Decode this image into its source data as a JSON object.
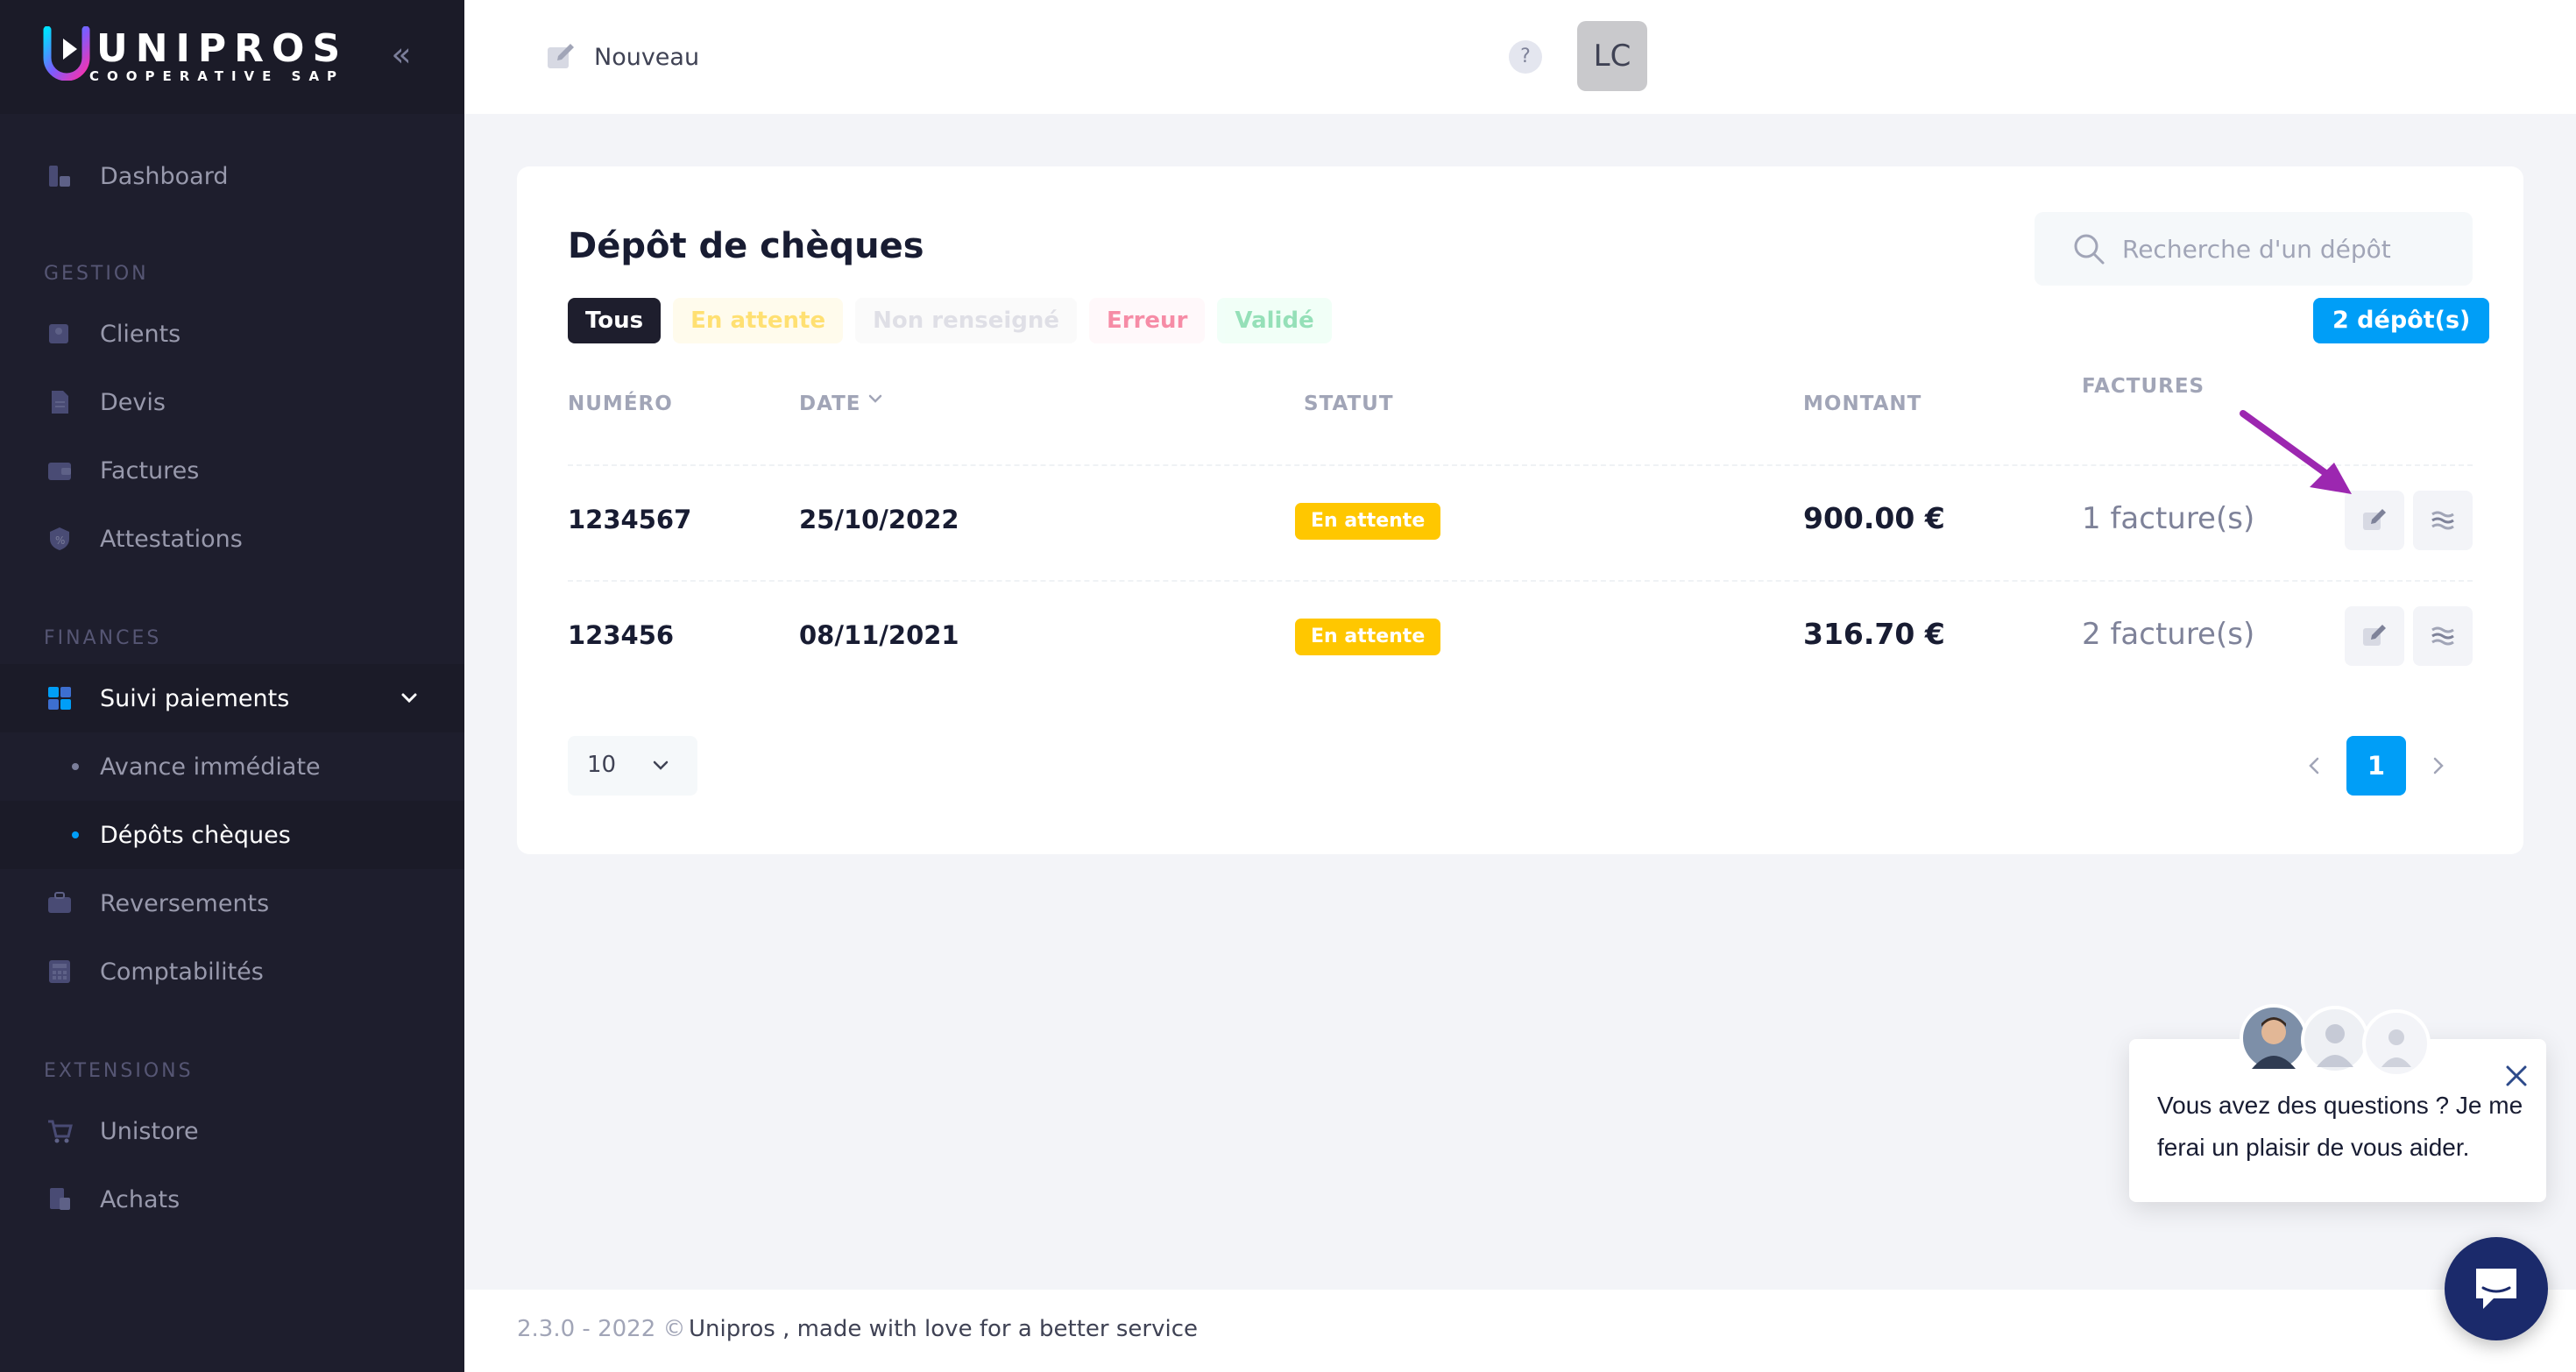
{
  "brand": {
    "name": "UNIPROS",
    "tagline": "COOPERATIVE SAP"
  },
  "sidebar": {
    "dashboard": "Dashboard",
    "sections": {
      "gestion": "GESTION",
      "finances": "FINANCES",
      "extensions": "EXTENSIONS"
    },
    "items": {
      "clients": "Clients",
      "devis": "Devis",
      "factures": "Factures",
      "attestations": "Attestations",
      "suivi": "Suivi paiements",
      "avance": "Avance immédiate",
      "depots": "Dépôts chèques",
      "reversements": "Reversements",
      "comptabilites": "Comptabilités",
      "unistore": "Unistore",
      "achats": "Achats"
    }
  },
  "header": {
    "new_label": "Nouveau",
    "help": "?",
    "avatar": "LC"
  },
  "card": {
    "title": "Dépôt de chèques",
    "search_placeholder": "Recherche d'un dépôt",
    "filters": {
      "all": "Tous",
      "wait": "En attente",
      "nr": "Non renseigné",
      "err": "Erreur",
      "ok": "Validé"
    },
    "count": "2 dépôt(s)",
    "columns": {
      "numero": "NUMÉRO",
      "date": "DATE",
      "statut": "STATUT",
      "montant": "MONTANT",
      "factures": "FACTURES"
    },
    "rows": [
      {
        "numero": "1234567",
        "date": "25/10/2022",
        "statut": "En attente",
        "montant": "900.00 €",
        "factures": "1 facture(s)"
      },
      {
        "numero": "123456",
        "date": "08/11/2021",
        "statut": "En attente",
        "montant": "316.70 €",
        "factures": "2 facture(s)"
      }
    ],
    "page_size": "10",
    "current_page": "1"
  },
  "footer": {
    "version": "2.3.0 - 2022 ©",
    "text": "Unipros , made with love for a better service"
  },
  "chat": {
    "message": "Vous avez des questions ? Je me ferai un plaisir de vous aider."
  },
  "colors": {
    "sidebar": "#1e1e2d",
    "primary": "#009ef7",
    "warning": "#ffc700",
    "annotation": "#9c27b0"
  }
}
